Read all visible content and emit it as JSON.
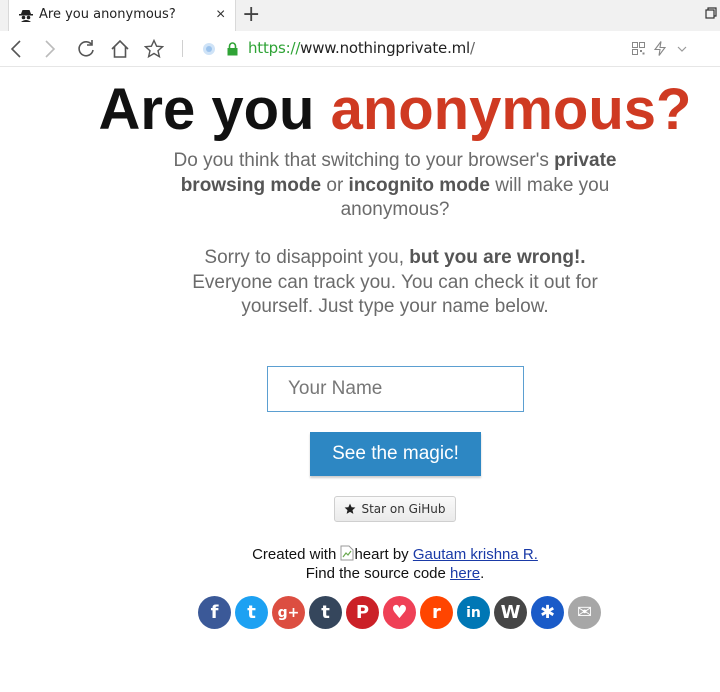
{
  "browser": {
    "tab_title": "Are you anonymous?",
    "tab_close": "×",
    "new_tab": "+",
    "url_scheme": "https://",
    "url_host": "www.nothingprivate.ml",
    "url_path": "/"
  },
  "page": {
    "headline_part1": "Are you ",
    "headline_part2": "anonymous?",
    "para1_before": "Do you think that switching to your browser's ",
    "para1_bold1": "private browsing mode",
    "para1_mid": " or ",
    "para1_bold2": "incognito mode",
    "para1_after": " will make you anonymous?",
    "para2_before": "Sorry to disappoint you, ",
    "para2_bold": "but you are wrong!.",
    "para2_after": " Everyone can track you. You can check it out for yourself. Just type your name below.",
    "name_placeholder": "Your Name",
    "magic_button": "See the magic!",
    "github_button": "Star on GiHub",
    "created_with": "Created with ",
    "heart_alt": "heart",
    "by_text": " by ",
    "author": "Gautam krishna R.",
    "find_source": "Find the source code ",
    "here": "here",
    "period": "."
  },
  "social": [
    {
      "name": "facebook-icon",
      "glyph": "f",
      "color": "#3b5998"
    },
    {
      "name": "twitter-icon",
      "glyph": "t",
      "color": "#1da1f2"
    },
    {
      "name": "google-plus-icon",
      "glyph": "g+",
      "color": "#dc4e41"
    },
    {
      "name": "tumblr-icon",
      "glyph": "t",
      "color": "#35465c"
    },
    {
      "name": "pinterest-icon",
      "glyph": "P",
      "color": "#cb2027"
    },
    {
      "name": "pocket-icon",
      "glyph": "♥",
      "color": "#ef4056"
    },
    {
      "name": "reddit-icon",
      "glyph": "r",
      "color": "#ff4500"
    },
    {
      "name": "linkedin-icon",
      "glyph": "in",
      "color": "#0077b5"
    },
    {
      "name": "wordpress-icon",
      "glyph": "W",
      "color": "#464646"
    },
    {
      "name": "pin-icon",
      "glyph": "✱",
      "color": "#1a5bc8"
    },
    {
      "name": "email-icon",
      "glyph": "✉",
      "color": "#a7a7a7"
    }
  ]
}
